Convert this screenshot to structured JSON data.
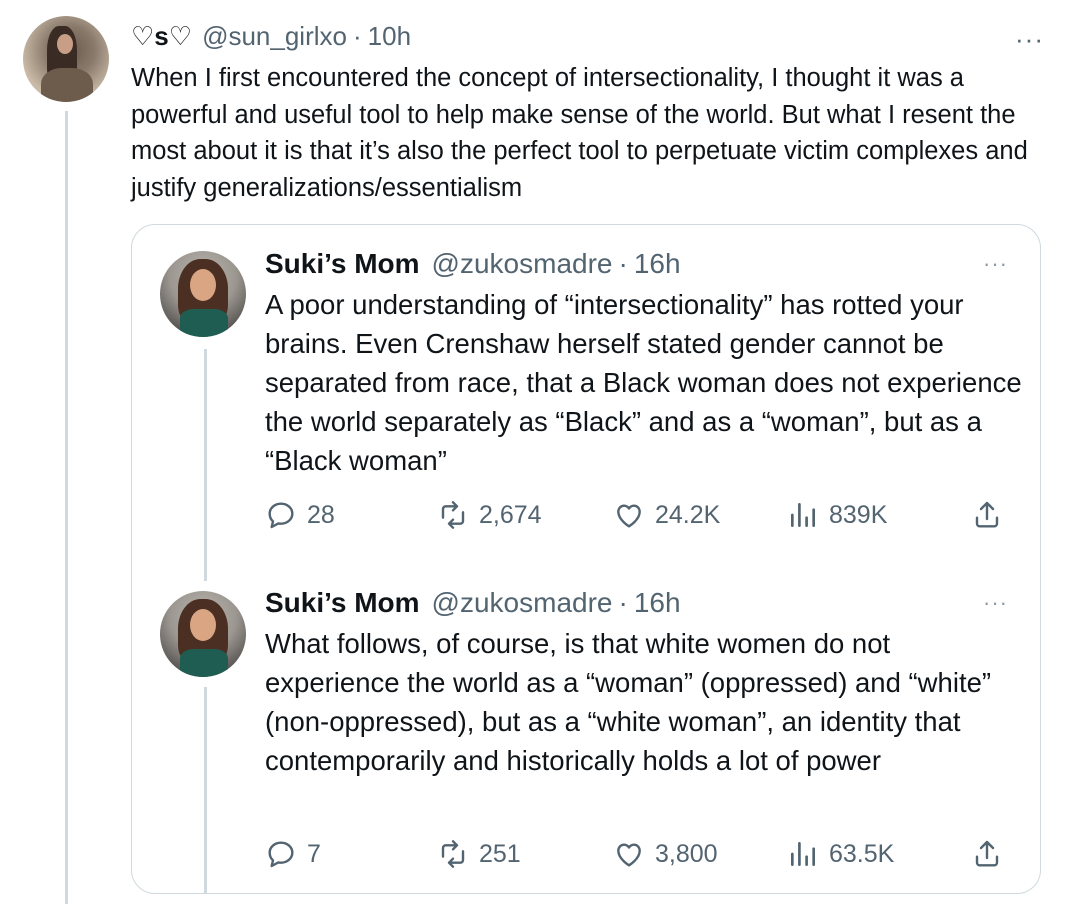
{
  "tweet": {
    "display_name": "♡s♡",
    "handle": "@sun_girlxo",
    "dot": "·",
    "time": "10h",
    "more": "···",
    "text": "When I first encountered the concept of intersectionality, I thought it was a powerful and useful tool to help make sense of the world. But what I resent the most about it is that it’s also the perfect tool to perpetuate victim complexes and justify generalizations/essentialism"
  },
  "quoted": [
    {
      "display_name": "Suki’s Mom",
      "handle": "@zukosmadre",
      "dot": "·",
      "time": "16h",
      "more": "···",
      "text": "A poor understanding of “intersectionality” has rotted your brains. Even Crenshaw herself stated gender cannot be separated from race, that a Black woman does not experience the world separately as “Black” and as a “woman”, but as a “Black woman”",
      "replies": "28",
      "reposts": "2,674",
      "likes": "24.2K",
      "views": "839K"
    },
    {
      "display_name": "Suki’s Mom",
      "handle": "@zukosmadre",
      "dot": "·",
      "time": "16h",
      "more": "···",
      "text": "What follows, of course, is that white women do not experience the world as a “woman” (oppressed) and “white” (non-oppressed), but as a “white woman”, an identity that contemporarily and historically holds a lot of power",
      "replies": "7",
      "reposts": "251",
      "likes": "3,800",
      "views": "63.5K"
    }
  ],
  "icons": {
    "reply": "reply-icon",
    "repost": "repost-icon",
    "like": "heart-icon",
    "views": "views-icon",
    "share": "share-icon"
  },
  "colors": {
    "text": "#0f1419",
    "muted": "#536471",
    "border": "#cfd9de"
  }
}
